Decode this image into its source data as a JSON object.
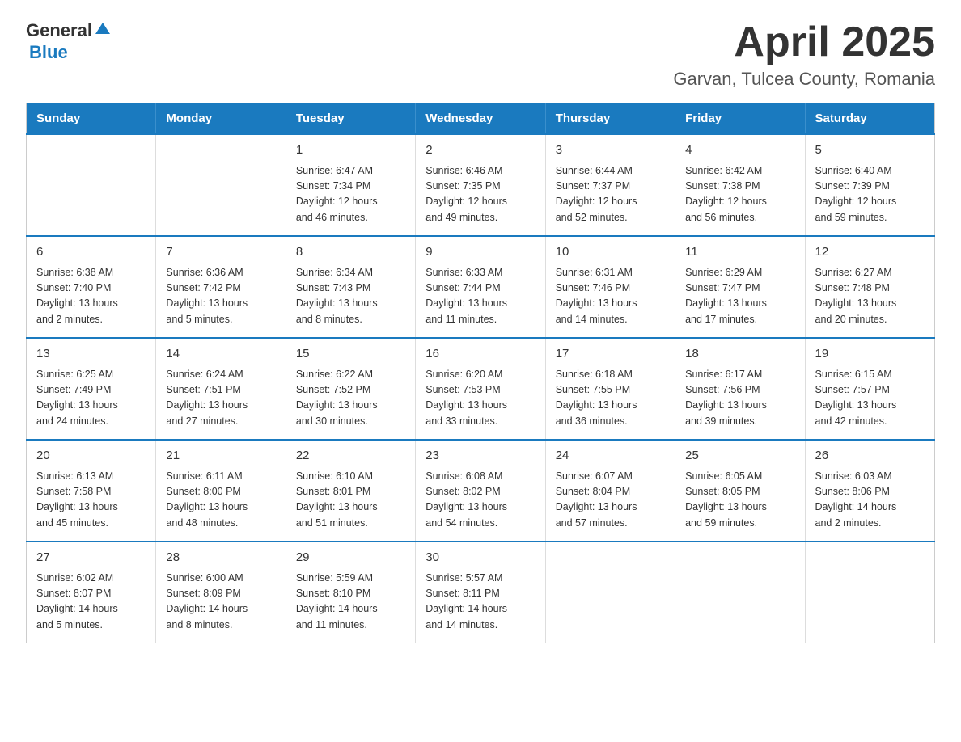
{
  "logo": {
    "general": "General",
    "blue": "Blue",
    "triangle": "▼"
  },
  "header": {
    "month_year": "April 2025",
    "location": "Garvan, Tulcea County, Romania"
  },
  "weekdays": [
    "Sunday",
    "Monday",
    "Tuesday",
    "Wednesday",
    "Thursday",
    "Friday",
    "Saturday"
  ],
  "weeks": [
    [
      {
        "day": "",
        "info": ""
      },
      {
        "day": "",
        "info": ""
      },
      {
        "day": "1",
        "info": "Sunrise: 6:47 AM\nSunset: 7:34 PM\nDaylight: 12 hours\nand 46 minutes."
      },
      {
        "day": "2",
        "info": "Sunrise: 6:46 AM\nSunset: 7:35 PM\nDaylight: 12 hours\nand 49 minutes."
      },
      {
        "day": "3",
        "info": "Sunrise: 6:44 AM\nSunset: 7:37 PM\nDaylight: 12 hours\nand 52 minutes."
      },
      {
        "day": "4",
        "info": "Sunrise: 6:42 AM\nSunset: 7:38 PM\nDaylight: 12 hours\nand 56 minutes."
      },
      {
        "day": "5",
        "info": "Sunrise: 6:40 AM\nSunset: 7:39 PM\nDaylight: 12 hours\nand 59 minutes."
      }
    ],
    [
      {
        "day": "6",
        "info": "Sunrise: 6:38 AM\nSunset: 7:40 PM\nDaylight: 13 hours\nand 2 minutes."
      },
      {
        "day": "7",
        "info": "Sunrise: 6:36 AM\nSunset: 7:42 PM\nDaylight: 13 hours\nand 5 minutes."
      },
      {
        "day": "8",
        "info": "Sunrise: 6:34 AM\nSunset: 7:43 PM\nDaylight: 13 hours\nand 8 minutes."
      },
      {
        "day": "9",
        "info": "Sunrise: 6:33 AM\nSunset: 7:44 PM\nDaylight: 13 hours\nand 11 minutes."
      },
      {
        "day": "10",
        "info": "Sunrise: 6:31 AM\nSunset: 7:46 PM\nDaylight: 13 hours\nand 14 minutes."
      },
      {
        "day": "11",
        "info": "Sunrise: 6:29 AM\nSunset: 7:47 PM\nDaylight: 13 hours\nand 17 minutes."
      },
      {
        "day": "12",
        "info": "Sunrise: 6:27 AM\nSunset: 7:48 PM\nDaylight: 13 hours\nand 20 minutes."
      }
    ],
    [
      {
        "day": "13",
        "info": "Sunrise: 6:25 AM\nSunset: 7:49 PM\nDaylight: 13 hours\nand 24 minutes."
      },
      {
        "day": "14",
        "info": "Sunrise: 6:24 AM\nSunset: 7:51 PM\nDaylight: 13 hours\nand 27 minutes."
      },
      {
        "day": "15",
        "info": "Sunrise: 6:22 AM\nSunset: 7:52 PM\nDaylight: 13 hours\nand 30 minutes."
      },
      {
        "day": "16",
        "info": "Sunrise: 6:20 AM\nSunset: 7:53 PM\nDaylight: 13 hours\nand 33 minutes."
      },
      {
        "day": "17",
        "info": "Sunrise: 6:18 AM\nSunset: 7:55 PM\nDaylight: 13 hours\nand 36 minutes."
      },
      {
        "day": "18",
        "info": "Sunrise: 6:17 AM\nSunset: 7:56 PM\nDaylight: 13 hours\nand 39 minutes."
      },
      {
        "day": "19",
        "info": "Sunrise: 6:15 AM\nSunset: 7:57 PM\nDaylight: 13 hours\nand 42 minutes."
      }
    ],
    [
      {
        "day": "20",
        "info": "Sunrise: 6:13 AM\nSunset: 7:58 PM\nDaylight: 13 hours\nand 45 minutes."
      },
      {
        "day": "21",
        "info": "Sunrise: 6:11 AM\nSunset: 8:00 PM\nDaylight: 13 hours\nand 48 minutes."
      },
      {
        "day": "22",
        "info": "Sunrise: 6:10 AM\nSunset: 8:01 PM\nDaylight: 13 hours\nand 51 minutes."
      },
      {
        "day": "23",
        "info": "Sunrise: 6:08 AM\nSunset: 8:02 PM\nDaylight: 13 hours\nand 54 minutes."
      },
      {
        "day": "24",
        "info": "Sunrise: 6:07 AM\nSunset: 8:04 PM\nDaylight: 13 hours\nand 57 minutes."
      },
      {
        "day": "25",
        "info": "Sunrise: 6:05 AM\nSunset: 8:05 PM\nDaylight: 13 hours\nand 59 minutes."
      },
      {
        "day": "26",
        "info": "Sunrise: 6:03 AM\nSunset: 8:06 PM\nDaylight: 14 hours\nand 2 minutes."
      }
    ],
    [
      {
        "day": "27",
        "info": "Sunrise: 6:02 AM\nSunset: 8:07 PM\nDaylight: 14 hours\nand 5 minutes."
      },
      {
        "day": "28",
        "info": "Sunrise: 6:00 AM\nSunset: 8:09 PM\nDaylight: 14 hours\nand 8 minutes."
      },
      {
        "day": "29",
        "info": "Sunrise: 5:59 AM\nSunset: 8:10 PM\nDaylight: 14 hours\nand 11 minutes."
      },
      {
        "day": "30",
        "info": "Sunrise: 5:57 AM\nSunset: 8:11 PM\nDaylight: 14 hours\nand 14 minutes."
      },
      {
        "day": "",
        "info": ""
      },
      {
        "day": "",
        "info": ""
      },
      {
        "day": "",
        "info": ""
      }
    ]
  ]
}
